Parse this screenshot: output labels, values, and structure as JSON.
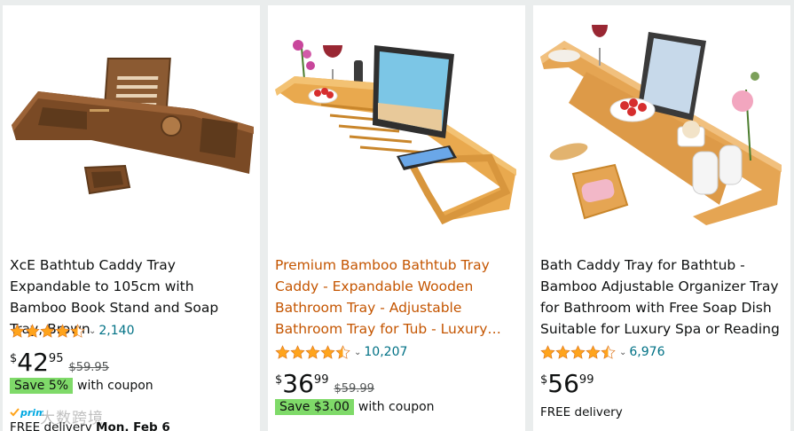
{
  "products": [
    {
      "title": "XcE Bathtub Caddy Tray Expandable to 105cm with Bamboo Book Stand and Soap Tray, Brown",
      "rating": 4.5,
      "review_count": "2,140",
      "currency": "$",
      "price_whole": "42",
      "price_fraction": "95",
      "list_price": "$59.95",
      "coupon_badge": "Save 5%",
      "coupon_text": "with coupon",
      "delivery_text": "FREE delivery",
      "delivery_date": "Mon, Feb 6",
      "prime_label": "prime",
      "watermark": "大数跨境"
    },
    {
      "title": "Premium Bamboo Bathtub Tray Caddy - Expandable Wooden Bathroom Tray - Adjustable Bathroom Tray for Tub - Luxury Bath Tray for Bathtub",
      "rating": 4.5,
      "review_count": "10,207",
      "currency": "$",
      "price_whole": "36",
      "price_fraction": "99",
      "list_price": "$59.99",
      "coupon_badge": "Save $3.00",
      "coupon_text": "with coupon"
    },
    {
      "title": "Bath Caddy Tray for Bathtub - Bamboo Adjustable Organizer Tray for Bathroom with Free Soap Dish Suitable for Luxury Spa or Reading",
      "rating": 4.5,
      "review_count": "6,976",
      "currency": "$",
      "price_whole": "56",
      "price_fraction": "99",
      "delivery_text": "FREE delivery"
    }
  ],
  "colors": {
    "star": "#ffa41c",
    "link": "#007185",
    "title_hover": "#c45500",
    "coupon_badge": "#7fda69",
    "prime": "#00a8e1"
  },
  "icons": [
    "star-icon",
    "half-star-icon",
    "chevron-down-icon",
    "prime-check-icon"
  ]
}
